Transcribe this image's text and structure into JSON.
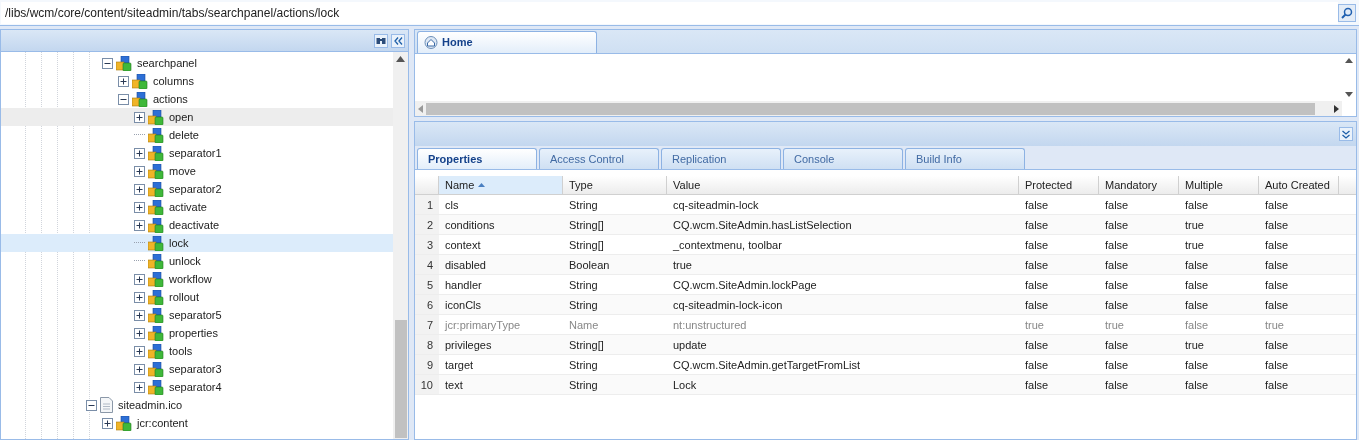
{
  "address_bar": {
    "value": "/libs/wcm/core/content/siteadmin/tabs/searchpanel/actions/lock"
  },
  "tree": {
    "items": [
      {
        "label": "searchpanel",
        "kind": "node",
        "expanded": true,
        "selected": false,
        "highlighted": false,
        "children": [
          {
            "label": "columns",
            "kind": "node",
            "expanded": false,
            "selected": false,
            "highlighted": false
          },
          {
            "label": "actions",
            "kind": "node",
            "expanded": true,
            "selected": false,
            "highlighted": false,
            "children": [
              {
                "label": "open",
                "kind": "node",
                "expanded": false,
                "selected": false,
                "highlighted": true
              },
              {
                "label": "delete",
                "kind": "node",
                "selected": false,
                "highlighted": false
              },
              {
                "label": "separator1",
                "kind": "node",
                "expanded": false,
                "selected": false,
                "highlighted": false
              },
              {
                "label": "move",
                "kind": "node",
                "expanded": false,
                "selected": false,
                "highlighted": false
              },
              {
                "label": "separator2",
                "kind": "node",
                "expanded": false,
                "selected": false,
                "highlighted": false
              },
              {
                "label": "activate",
                "kind": "node",
                "expanded": false,
                "selected": false,
                "highlighted": false
              },
              {
                "label": "deactivate",
                "kind": "node",
                "expanded": false,
                "selected": false,
                "highlighted": false
              },
              {
                "label": "lock",
                "kind": "node",
                "selected": true,
                "highlighted": false
              },
              {
                "label": "unlock",
                "kind": "node",
                "selected": false,
                "highlighted": false
              },
              {
                "label": "workflow",
                "kind": "node",
                "expanded": false,
                "selected": false,
                "highlighted": false
              },
              {
                "label": "rollout",
                "kind": "node",
                "expanded": false,
                "selected": false,
                "highlighted": false
              },
              {
                "label": "separator5",
                "kind": "node",
                "expanded": false,
                "selected": false,
                "highlighted": false
              },
              {
                "label": "properties",
                "kind": "node",
                "expanded": false,
                "selected": false,
                "highlighted": false
              },
              {
                "label": "tools",
                "kind": "node",
                "expanded": false,
                "selected": false,
                "highlighted": false
              },
              {
                "label": "separator3",
                "kind": "node",
                "expanded": false,
                "selected": false,
                "highlighted": false
              },
              {
                "label": "separator4",
                "kind": "node",
                "expanded": false,
                "selected": false,
                "highlighted": false
              }
            ]
          }
        ]
      },
      {
        "label": "siteadmin.ico",
        "kind": "file",
        "expanded": true,
        "selected": false,
        "highlighted": false,
        "children": [
          {
            "label": "jcr:content",
            "kind": "node",
            "expanded": false,
            "selected": false,
            "highlighted": false
          }
        ]
      }
    ]
  },
  "editor_tabs": [
    {
      "label": "Home",
      "selected": true
    }
  ],
  "properties_tabs": [
    {
      "label": "Properties",
      "selected": true
    },
    {
      "label": "Access Control",
      "selected": false
    },
    {
      "label": "Replication",
      "selected": false
    },
    {
      "label": "Console",
      "selected": false
    },
    {
      "label": "Build Info",
      "selected": false
    }
  ],
  "table": {
    "columns": [
      {
        "label": "Name",
        "sorted": true
      },
      {
        "label": "Type",
        "sorted": false
      },
      {
        "label": "Value",
        "sorted": false
      },
      {
        "label": "Protected",
        "sorted": false
      },
      {
        "label": "Mandatory",
        "sorted": false
      },
      {
        "label": "Multiple",
        "sorted": false
      },
      {
        "label": "Auto Created",
        "sorted": false
      }
    ],
    "rows": [
      {
        "index": "1",
        "cells": [
          "cls",
          "String",
          "cq-siteadmin-lock",
          "false",
          "false",
          "false",
          "false"
        ],
        "greyed": false
      },
      {
        "index": "2",
        "cells": [
          "conditions",
          "String[]",
          "CQ.wcm.SiteAdmin.hasListSelection",
          "false",
          "false",
          "true",
          "false"
        ],
        "greyed": false
      },
      {
        "index": "3",
        "cells": [
          "context",
          "String[]",
          "_contextmenu, toolbar",
          "false",
          "false",
          "true",
          "false"
        ],
        "greyed": false
      },
      {
        "index": "4",
        "cells": [
          "disabled",
          "Boolean",
          "true",
          "false",
          "false",
          "false",
          "false"
        ],
        "greyed": false
      },
      {
        "index": "5",
        "cells": [
          "handler",
          "String",
          "CQ.wcm.SiteAdmin.lockPage",
          "false",
          "false",
          "false",
          "false"
        ],
        "greyed": false
      },
      {
        "index": "6",
        "cells": [
          "iconCls",
          "String",
          "cq-siteadmin-lock-icon",
          "false",
          "false",
          "false",
          "false"
        ],
        "greyed": false
      },
      {
        "index": "7",
        "cells": [
          "jcr:primaryType",
          "Name",
          "nt:unstructured",
          "true",
          "true",
          "false",
          "true"
        ],
        "greyed": true
      },
      {
        "index": "8",
        "cells": [
          "privileges",
          "String[]",
          "update",
          "false",
          "false",
          "true",
          "false"
        ],
        "greyed": false
      },
      {
        "index": "9",
        "cells": [
          "target",
          "String",
          "CQ.wcm.SiteAdmin.getTargetFromList",
          "false",
          "false",
          "false",
          "false"
        ],
        "greyed": false
      },
      {
        "index": "10",
        "cells": [
          "text",
          "String",
          "Lock",
          "false",
          "false",
          "false",
          "false"
        ],
        "greyed": false
      }
    ]
  }
}
